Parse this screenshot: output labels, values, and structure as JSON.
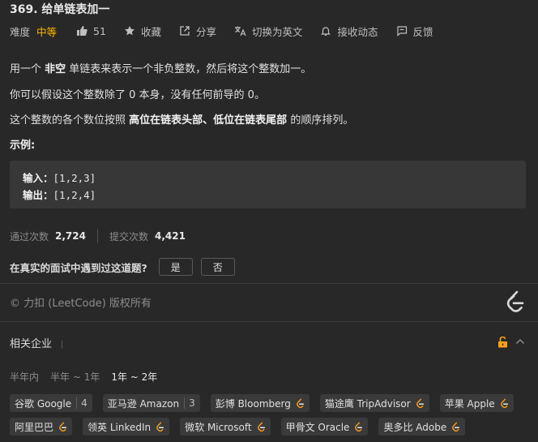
{
  "problem": {
    "title": "369. 给单链表加一"
  },
  "toolbar": {
    "difficulty_label": "难度",
    "difficulty": "中等",
    "likes": "51",
    "favorite": "收藏",
    "share": "分享",
    "switch_lang": "切换为英文",
    "notify": "接收动态",
    "feedback": "反馈"
  },
  "colors": {
    "background": "#282828",
    "difficulty_medium": "#ffb800",
    "lock": "#ffa116"
  },
  "description": {
    "p1_a": "用一个 ",
    "p1_b": "非空",
    "p1_c": " 单链表来表示一个非负整数，然后将这个整数加一。",
    "p2": "你可以假设这个整数除了 0 本身，没有任何前导的 0。",
    "p3_a": "这个整数的各个数位按照 ",
    "p3_b": "高位在链表头部",
    "p3_c": "、",
    "p3_d": "低位在链表尾部",
    "p3_e": " 的顺序排列。",
    "example_title": "示例:",
    "input_label": "输入：",
    "input_value": "[1,2,3]",
    "output_label": "输出：",
    "output_value": "[1,2,4]"
  },
  "stats": {
    "accepted_label": "通过次数",
    "accepted": "2,724",
    "submitted_label": "提交次数",
    "submitted": "4,421"
  },
  "interview": {
    "question": "在真实的面试中遇到过这道题?",
    "yes": "是",
    "no": "否"
  },
  "footer": {
    "copyright": "© 力扣 (LeetCode) 版权所有"
  },
  "companies": {
    "title": "相关企业",
    "periods": [
      "半年内",
      "半年 ~ 1年",
      "1年 ~ 2年"
    ],
    "active_period": "1年 ~ 2年",
    "row1": [
      {
        "name": "谷歌 Google",
        "count": "4"
      },
      {
        "name": "亚马逊 Amazon",
        "count": "3"
      },
      {
        "name": "彭博 Bloomberg",
        "icon": "leetcode-icon"
      },
      {
        "name": "猫途鹰 TripAdvisor",
        "icon": "leetcode-icon"
      },
      {
        "name": "苹果 Apple",
        "icon": "leetcode-icon"
      }
    ],
    "row2": [
      {
        "name": "阿里巴巴",
        "icon": "leetcode-icon"
      },
      {
        "name": "领英 LinkedIn",
        "icon": "leetcode-icon"
      },
      {
        "name": "微软 Microsoft",
        "icon": "leetcode-icon"
      },
      {
        "name": "甲骨文 Oracle",
        "icon": "leetcode-icon"
      },
      {
        "name": "奥多比 Adobe",
        "icon": "leetcode-icon"
      }
    ]
  }
}
